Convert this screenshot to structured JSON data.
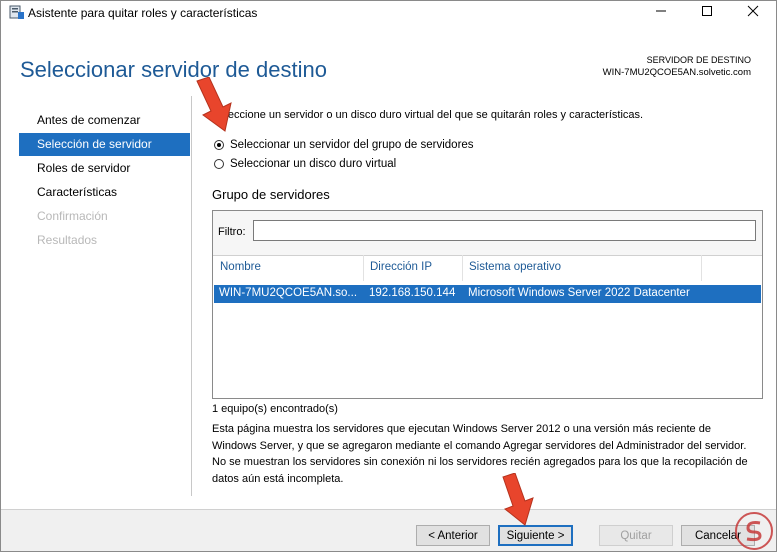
{
  "window": {
    "title": "Asistente para quitar roles y características",
    "icon": "server-manager-icon",
    "controls": [
      "minimize-icon",
      "maximize-icon",
      "close-icon"
    ]
  },
  "header": {
    "title": "Seleccionar servidor de destino",
    "destination_label": "SERVIDOR DE DESTINO",
    "destination_server": "WIN-7MU2QCOE5AN.solvetic.com"
  },
  "sidebar": {
    "items": [
      {
        "label": "Antes de comenzar",
        "state": "normal"
      },
      {
        "label": "Selección de servidor",
        "state": "active"
      },
      {
        "label": "Roles de servidor",
        "state": "normal"
      },
      {
        "label": "Características",
        "state": "normal"
      },
      {
        "label": "Confirmación",
        "state": "disabled"
      },
      {
        "label": "Resultados",
        "state": "disabled"
      }
    ]
  },
  "main": {
    "description": "Seleccione un servidor o un disco duro virtual del que se quitarán roles y características.",
    "options": [
      {
        "label": "Seleccionar un servidor del grupo de servidores",
        "checked": true
      },
      {
        "label": "Seleccionar un disco duro virtual",
        "checked": false
      }
    ],
    "group_title": "Grupo de servidores",
    "filter_label": "Filtro:",
    "filter_value": "",
    "columns": [
      "Nombre",
      "Dirección IP",
      "Sistema operativo"
    ],
    "rows": [
      {
        "name": "WIN-7MU2QCOE5AN.so...",
        "ip": "192.168.150.144",
        "os": "Microsoft Windows Server 2022 Datacenter",
        "selected": true
      }
    ],
    "count_text": "1 equipo(s) encontrado(s)",
    "info_text": "Esta página muestra los servidores que ejecutan Windows Server 2012 o una versión más reciente de Windows Server, y que se agregaron mediante el comando Agregar servidores del Administrador del servidor. No se muestran los servidores sin conexión ni los servidores recién agregados para los que la recopilación de datos aún está incompleta."
  },
  "footer": {
    "back_label": "< Anterior",
    "next_label": "Siguiente >",
    "remove_label": "Quitar",
    "cancel_label": "Cancelar"
  },
  "colors": {
    "accent": "#1e6fc0",
    "title_blue": "#1e5a96",
    "arrow_red": "#e8452c"
  }
}
